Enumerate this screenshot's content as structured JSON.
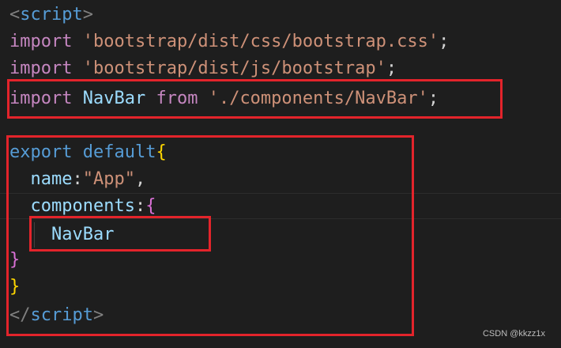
{
  "code": {
    "l1": {
      "open": "<",
      "tag": "script",
      "close": ">"
    },
    "l2": {
      "kw": "import",
      "sp": " ",
      "str": "'bootstrap/dist/css/bootstrap.css'",
      "end": ";"
    },
    "l3": {
      "kw": "import",
      "sp": " ",
      "str": "'bootstrap/dist/js/bootstrap'",
      "end": ";"
    },
    "l4": {
      "kw": "import",
      "sp1": " ",
      "ident": "NavBar",
      "sp2": " ",
      "from": "from",
      "sp3": " ",
      "str": "'./components/NavBar'",
      "end": ";"
    },
    "l5": {
      "kw1": "export",
      "sp": " ",
      "kw2": "default",
      "brace": "{"
    },
    "l6": {
      "indent": "  ",
      "key": "name",
      "colon": ":",
      "str": "\"App\"",
      "comma": ","
    },
    "l7": {
      "indent": "  ",
      "key": "components",
      "colon": ":",
      "brace": "{"
    },
    "l8": {
      "indent": "    ",
      "ident": "NavBar"
    },
    "l9": {
      "brace": "}"
    },
    "l10": {
      "brace": "}"
    },
    "l11": {
      "open": "</",
      "tag": "script",
      "close": ">"
    }
  },
  "watermark": "CSDN @kkzz1x",
  "colors": {
    "background": "#1e1e1e",
    "highlight_box": "#e3242b",
    "keyword": "#c586c0",
    "string": "#ce9178",
    "identifier": "#9cdcfe",
    "tag": "#569cd6",
    "brace_level1": "#ffd700",
    "brace_level2": "#da70d6"
  }
}
